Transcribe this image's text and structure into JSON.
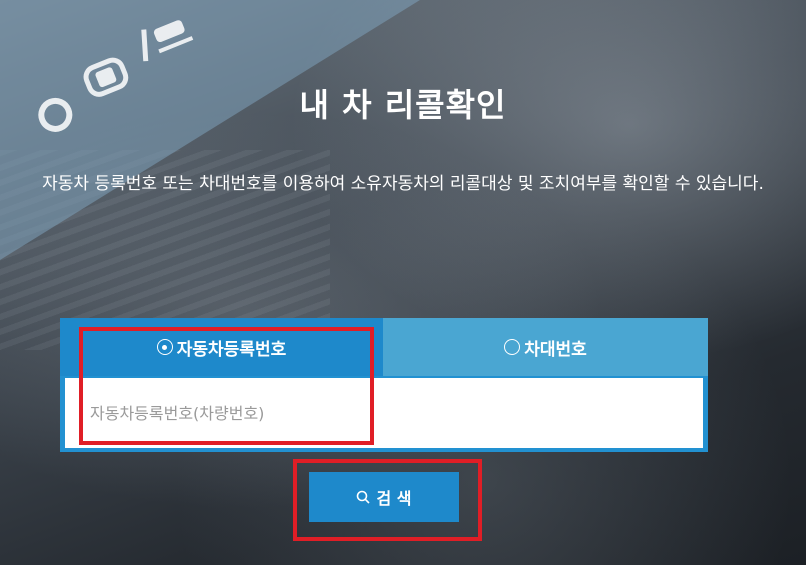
{
  "page": {
    "title": "내 차 리콜확인",
    "description": "자동차 등록번호 또는 차대번호를 이용하여 소유자동차의 리콜대상 및 조치여부를 확인할 수 있습니다."
  },
  "tabs": [
    {
      "label": "자동차등록번호",
      "icon": "radio-selected-icon",
      "selected": true
    },
    {
      "label": "차대번호",
      "icon": "radio-empty-icon",
      "selected": false
    }
  ],
  "search": {
    "placeholder": "자동차등록번호(차량번호)",
    "value": "",
    "button_label": "검 색",
    "button_icon": "search-icon"
  },
  "colors": {
    "accent": "#1e89cb",
    "tab_inactive": "#4aa6d2",
    "highlight": "#e01e26",
    "text_light": "#ffffff"
  }
}
